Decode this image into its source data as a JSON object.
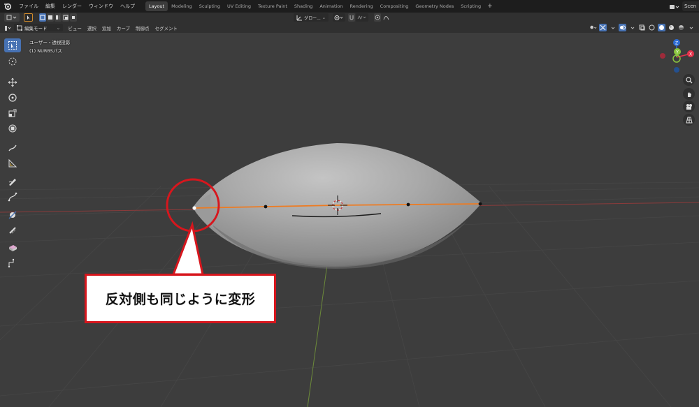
{
  "menu": {
    "items": [
      "ファイル",
      "編集",
      "レンダー",
      "ウィンドウ",
      "ヘルプ"
    ]
  },
  "workspaces": {
    "tabs": [
      "Layout",
      "Modeling",
      "Sculpting",
      "UV Editing",
      "Texture Paint",
      "Shading",
      "Animation",
      "Rendering",
      "Compositing",
      "Geometry Nodes",
      "Scripting"
    ],
    "active": "Layout",
    "add_label": "+"
  },
  "scene": {
    "label": "Scen"
  },
  "header": {
    "mode_label": "編集モード",
    "menus": [
      "ビュー",
      "選択",
      "追加",
      "カーブ",
      "制御点",
      "セグメント"
    ],
    "transform_orientation": "グロー..."
  },
  "viewport": {
    "view_name": "ユーザー・透視投影",
    "object_name": "(1) NURBSパス"
  },
  "gizmo": {
    "x_label": "X",
    "y_label": "Y",
    "z_label": "Z",
    "x_color": "#e5334b",
    "y_color": "#8bc63e",
    "z_color": "#2d6cd6"
  },
  "annotation": {
    "text": "反対側も同じように変形",
    "color": "#d7161d"
  },
  "colors": {
    "accent": "#4772b3",
    "curve": "#ee7b21",
    "x_axis": "#8b3b3b",
    "y_axis": "#6c8a3a"
  }
}
